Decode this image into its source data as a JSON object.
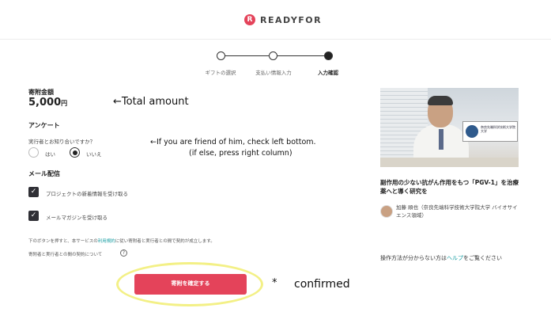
{
  "header": {
    "logo_text": "READYFOR"
  },
  "steps": [
    {
      "label": "ギフトの選択"
    },
    {
      "label": "支払い情報入力"
    },
    {
      "label": "入力確認"
    }
  ],
  "amount": {
    "label": "寄附金額",
    "value": "5,000",
    "unit": "円"
  },
  "survey": {
    "title": "アンケート",
    "question": "実行者とお知り合いですか？",
    "options": [
      "はい",
      "いいえ"
    ],
    "selected": "いいえ"
  },
  "mail": {
    "title": "メール配信",
    "items": [
      {
        "label": "プロジェクトの新着情報を受け取る",
        "checked": true
      },
      {
        "label": "メールマガジンを受け取る",
        "checked": true
      }
    ]
  },
  "terms": {
    "line1_pre": "下のボタンを押すと、本サービスの",
    "line1_link": "利用規約",
    "line1_post": "に従い寄附者と実行者との間で契約が成立します。",
    "line2": "寄附者と実行者との間の契約について"
  },
  "confirm_button": "寄附を確定する",
  "project": {
    "title": "副作用の少ない抗がん作用をもつ「PGV-1」を治療薬へと導く研究を",
    "author": "加藤 順也（奈良先端科学技術大学院大学 バイオサイエンス領域）",
    "photo_sign_text": "奈良先端科学技術大学院大学"
  },
  "help": {
    "pre": "操作方法が分からない方は",
    "link": "ヘルプ",
    "post": "をご覧ください"
  },
  "annotations": {
    "total": "←Total amount",
    "friend_line1": "←If you are friend of him, check left bottom.",
    "friend_line2": "(if else, press right column)",
    "star": "*",
    "confirmed": "confirmed"
  },
  "colors": {
    "accent": "#e4435a",
    "link": "#1a9ea3",
    "highlight": "#f3f086"
  }
}
